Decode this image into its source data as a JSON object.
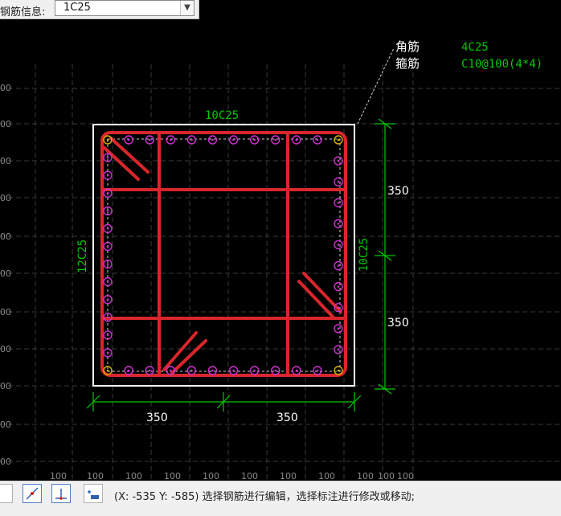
{
  "toolbar": {
    "label": "钢筋信息:",
    "rebar_value": "1C25"
  },
  "drawing": {
    "legend": {
      "corner_label": "角筋",
      "corner_value": "4C25",
      "stirrup_label": "箍筋",
      "stirrup_value": "C10@100(4*4)"
    },
    "top_bars": "10C25",
    "left_bars": "12C25",
    "right_bars": "10C25",
    "dim_right_upper": "350",
    "dim_right_lower": "350",
    "dim_bottom_left": "350",
    "dim_bottom_right": "350",
    "grid_left_labels": [
      "00",
      "00",
      "00",
      "00",
      "00",
      "00",
      "00",
      "00",
      "00",
      "00",
      "00"
    ],
    "grid_bottom_labels": [
      "100",
      "100",
      "100",
      "100",
      "100",
      "100",
      "100",
      "100",
      "100",
      "100",
      "100"
    ]
  },
  "status": {
    "coords": "(X: -535 Y: -585)",
    "message": "选择钢筋进行编辑，选择标注进行修改或移动;",
    "tools": [
      "snap-tool-icon",
      "perpendicular-tool-icon",
      "dimension-tool-icon"
    ]
  },
  "colors": {
    "background": "#000000",
    "rebar": "#d9262b",
    "annotation": "#00c800",
    "dimension_text": "#ffffff",
    "tie_bar": "#d030d0",
    "corner_bar": "#d8b000",
    "section_outline": "#ffffff"
  }
}
